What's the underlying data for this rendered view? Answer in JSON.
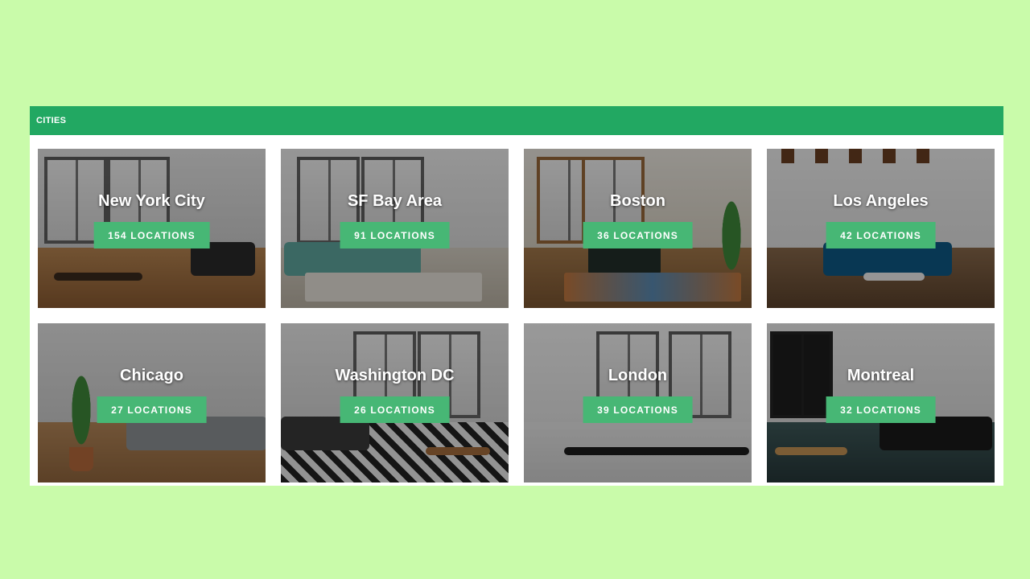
{
  "section": {
    "title": "CITIES"
  },
  "colors": {
    "page_bg": "#c9fbaa",
    "header": "#22a862",
    "button": "#47b775"
  },
  "cities": [
    {
      "name": "New York City",
      "locations": "154 LOCATIONS"
    },
    {
      "name": "SF Bay Area",
      "locations": "91 LOCATIONS"
    },
    {
      "name": "Boston",
      "locations": "36 LOCATIONS"
    },
    {
      "name": "Los Angeles",
      "locations": "42 LOCATIONS"
    },
    {
      "name": "Chicago",
      "locations": "27 LOCATIONS"
    },
    {
      "name": "Washington DC",
      "locations": "26 LOCATIONS"
    },
    {
      "name": "London",
      "locations": "39 LOCATIONS"
    },
    {
      "name": "Montreal",
      "locations": "32 LOCATIONS"
    }
  ]
}
